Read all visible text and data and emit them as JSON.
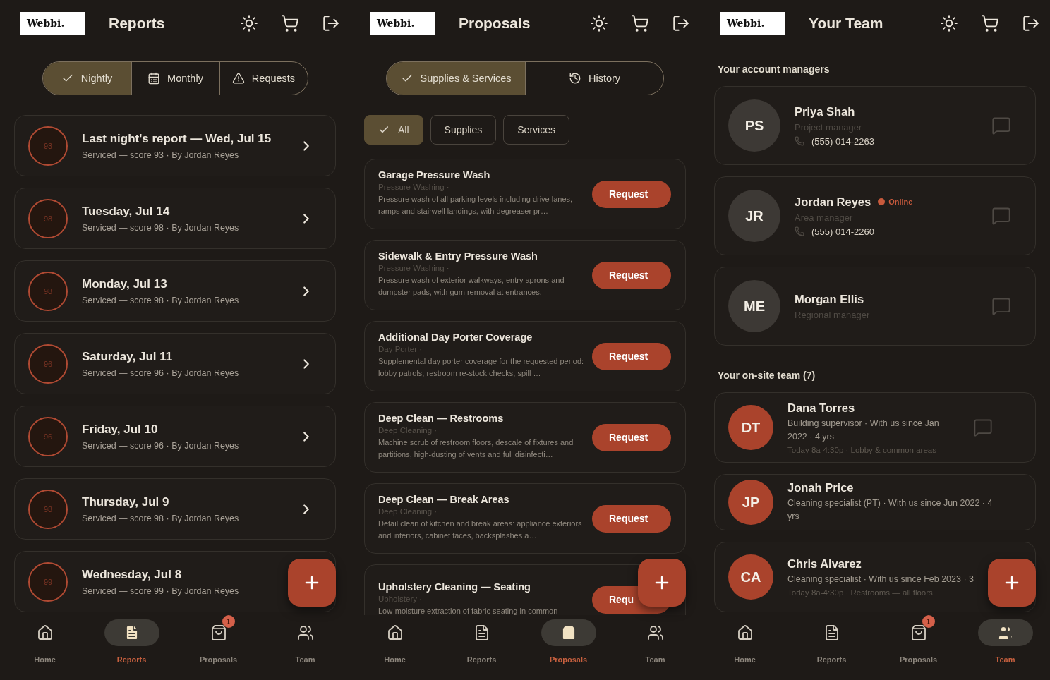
{
  "screens": [
    {
      "kind": "reports",
      "logo": "Webbi.",
      "title": "Reports",
      "segments": [
        {
          "label": "Nightly",
          "selected": true
        },
        {
          "label": "Monthly",
          "selected": false
        },
        {
          "label": "Requests",
          "selected": false
        }
      ],
      "reports": [
        {
          "score": "93",
          "title": "Last night's report — Wed, Jul 15",
          "subtitle": "Serviced — score 93 · By Jordan Reyes"
        },
        {
          "score": "98",
          "title": "Tuesday, Jul 14",
          "subtitle": "Serviced — score 98 · By Jordan Reyes"
        },
        {
          "score": "98",
          "title": "Monday, Jul 13",
          "subtitle": "Serviced — score 98 · By Jordan Reyes"
        },
        {
          "score": "96",
          "title": "Saturday, Jul 11",
          "subtitle": "Serviced — score 96 · By Jordan Reyes"
        },
        {
          "score": "96",
          "title": "Friday, Jul 10",
          "subtitle": "Serviced — score 96 · By Jordan Reyes"
        },
        {
          "score": "98",
          "title": "Thursday, Jul 9",
          "subtitle": "Serviced — score 98 · By Jordan Reyes"
        },
        {
          "score": "99",
          "title": "Wednesday, Jul 8",
          "subtitle": "Serviced — score 99 · By Jordan Reyes"
        }
      ],
      "nav": [
        {
          "label": "Home",
          "selected": false
        },
        {
          "label": "Reports",
          "selected": true
        },
        {
          "label": "Proposals",
          "selected": false,
          "badge": "1"
        },
        {
          "label": "Team",
          "selected": false
        }
      ]
    },
    {
      "kind": "proposals",
      "logo": "Webbi.",
      "title": "Proposals",
      "segments": [
        {
          "label": "Supplies & Services",
          "selected": true
        },
        {
          "label": "History",
          "selected": false
        }
      ],
      "filters": [
        {
          "label": "All",
          "selected": true
        },
        {
          "label": "Supplies",
          "selected": false
        },
        {
          "label": "Services",
          "selected": false
        }
      ],
      "items": [
        {
          "title": "Garage Pressure Wash",
          "category": "Pressure Washing ·",
          "description": "Pressure wash of all parking levels including drive lanes, ramps and stairwell landings, with degreaser pr…",
          "button": "Request"
        },
        {
          "title": "Sidewalk & Entry Pressure Wash",
          "category": "Pressure Washing ·",
          "description": "Pressure wash of exterior walkways, entry aprons and dumpster pads, with gum removal at entrances.",
          "button": "Request"
        },
        {
          "title": "Additional Day Porter Coverage",
          "category": "Day Porter ·",
          "description": "Supplemental day porter coverage for the requested period: lobby patrols, restroom re-stock checks, spill …",
          "button": "Request"
        },
        {
          "title": "Deep Clean — Restrooms",
          "category": "Deep Cleaning ·",
          "description": "Machine scrub of restroom floors, descale of fixtures and partitions, high-dusting of vents and full disinfecti…",
          "button": "Request"
        },
        {
          "title": "Deep Clean — Break Areas",
          "category": "Deep Cleaning ·",
          "description": "Detail clean of kitchen and break areas: appliance exteriors and interiors, cabinet faces, backsplashes a…",
          "button": "Request"
        },
        {
          "title": "Upholstery Cleaning — Seating",
          "category": "Upholstery ·",
          "description": "Low-moisture extraction of fabric seating in common",
          "button": "Requ"
        }
      ],
      "nav": [
        {
          "label": "Home",
          "selected": false
        },
        {
          "label": "Reports",
          "selected": false
        },
        {
          "label": "Proposals",
          "selected": true
        },
        {
          "label": "Team",
          "selected": false
        }
      ]
    },
    {
      "kind": "team",
      "logo": "Webbi.",
      "title": "Your Team",
      "managers_heading": "Your account managers",
      "managers": [
        {
          "initials": "PS",
          "name": "Priya Shah",
          "role": "Project manager",
          "phone": "(555) 014-2263",
          "online": false,
          "chat": true
        },
        {
          "initials": "JR",
          "name": "Jordan Reyes",
          "role": "Area manager",
          "phone": "(555) 014-2260",
          "online": true,
          "status": "Online",
          "chat": true
        },
        {
          "initials": "ME",
          "name": "Morgan Ellis",
          "role": "Regional manager",
          "online": false,
          "chat": true
        }
      ],
      "team_heading": "Your on-site team (7)",
      "team": [
        {
          "initials": "DT",
          "name": "Dana Torres",
          "detail": "Building supervisor · With us since Jan 2022 · 4 yrs",
          "schedule": "Today 8a-4:30p · Lobby & common areas",
          "chat": true
        },
        {
          "initials": "JP",
          "name": "Jonah Price",
          "detail": "Cleaning specialist (PT) · With us since Jun 2022 · 4 yrs",
          "chat": false
        },
        {
          "initials": "CA",
          "name": "Chris Alvarez",
          "detail": "Cleaning specialist · With us since Feb 2023 · 3",
          "schedule": "Today 8a-4:30p · Restrooms — all floors",
          "chat": false
        }
      ],
      "nav": [
        {
          "label": "Home",
          "selected": false
        },
        {
          "label": "Reports",
          "selected": false
        },
        {
          "label": "Proposals",
          "selected": false,
          "badge": "1"
        },
        {
          "label": "Team",
          "selected": true
        }
      ]
    }
  ]
}
